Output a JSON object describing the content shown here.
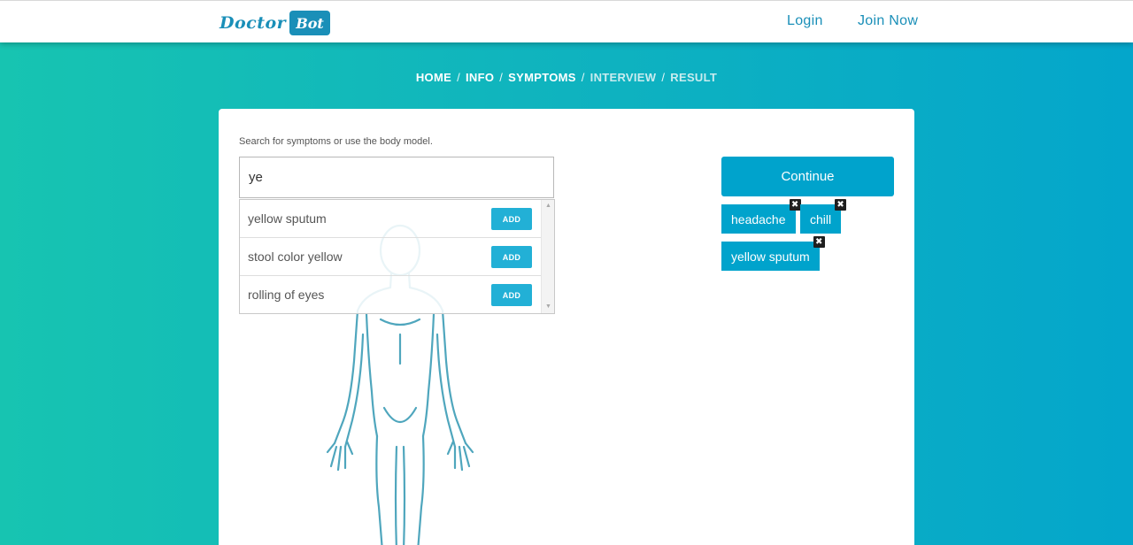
{
  "header": {
    "logo_word1": "Doctor",
    "logo_word2": "Bot",
    "nav": {
      "login": "Login",
      "join": "Join Now"
    }
  },
  "breadcrumb": {
    "items": [
      {
        "label": "HOME",
        "active": true
      },
      {
        "label": "INFO",
        "active": true
      },
      {
        "label": "SYMPTOMS",
        "active": true
      },
      {
        "label": "INTERVIEW",
        "active": false
      },
      {
        "label": "RESULT",
        "active": false
      }
    ],
    "separator": "/"
  },
  "search": {
    "label": "Search for symptoms or use the body model.",
    "value": "ye",
    "suggestions": [
      {
        "text": "yellow sputum",
        "add_label": "ADD"
      },
      {
        "text": "stool color yellow",
        "add_label": "ADD"
      },
      {
        "text": "rolling of eyes",
        "add_label": "ADD"
      }
    ]
  },
  "continue_label": "Continue",
  "selected_symptoms": [
    "headache",
    "chill",
    "yellow sputum"
  ],
  "icons": {
    "remove": "close-icon",
    "scroll_up": "arrow-up-icon",
    "scroll_down": "arrow-down-icon"
  },
  "colors": {
    "brand": "#1a8fb8",
    "accent": "#00a3cc",
    "add_button": "#22b0d6",
    "gradient_start": "#17c4b1",
    "gradient_end": "#04a6cb"
  }
}
